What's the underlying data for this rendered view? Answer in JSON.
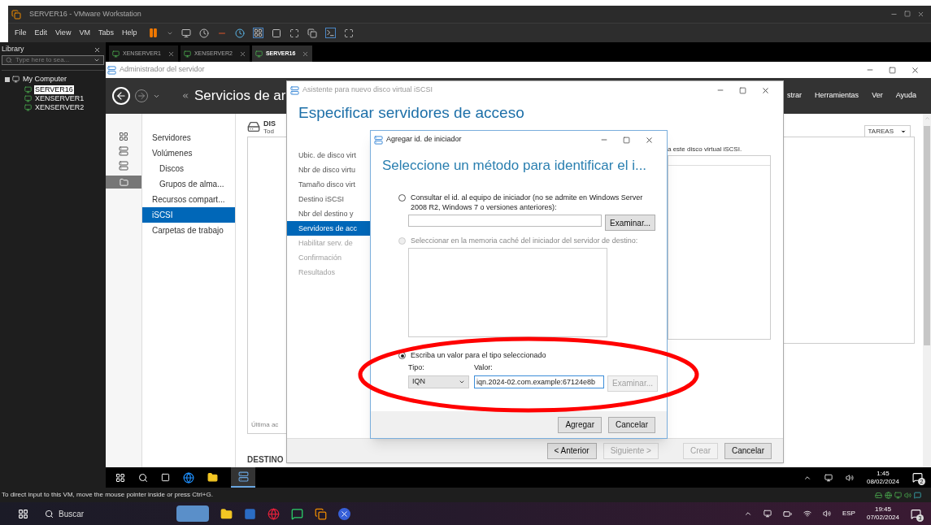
{
  "vmware": {
    "title": "SERVER16 - VMware Workstation",
    "menu": [
      "File",
      "Edit",
      "View",
      "VM",
      "Tabs",
      "Help"
    ]
  },
  "library": {
    "title": "Library",
    "search_placeholder": "Type here to sea...",
    "tree": [
      {
        "label": "My Computer",
        "expanded": true,
        "selected": false,
        "children": [
          {
            "label": "SERVER16",
            "selected": true
          },
          {
            "label": "XENSERVER1",
            "selected": false
          },
          {
            "label": "XENSERVER2",
            "selected": false
          }
        ]
      }
    ]
  },
  "vm_tabs": [
    {
      "label": "XENSERVER1",
      "selected": false
    },
    {
      "label": "XENSERVER2",
      "selected": false
    },
    {
      "label": "SERVER16",
      "selected": true
    }
  ],
  "server_manager": {
    "title": "Administrador del servidor",
    "breadcrumb": "Servicios de ar",
    "menu": [
      "strar",
      "Herramientas",
      "Ver",
      "Ayuda"
    ],
    "nav": [
      {
        "label": "Servidores",
        "selected": false
      },
      {
        "label": "Volúmenes",
        "selected": false,
        "children": [
          {
            "label": "Discos",
            "selected": false
          },
          {
            "label": "Grupos de alma...",
            "selected": false
          }
        ]
      },
      {
        "label": "Recursos compart...",
        "selected": false
      },
      {
        "label": "iSCSI",
        "selected": true
      },
      {
        "label": "Carpetas de trabajo",
        "selected": false
      }
    ],
    "content": {
      "heading": "DIS",
      "subheading": "Tod",
      "last_updated": "Última ac",
      "section": "DESTINO",
      "tasks_button": "TAREAS"
    }
  },
  "wizard": {
    "title": "Asistente para nuevo disco virtual iSCSI",
    "heading": "Especificar servidores de acceso",
    "steps": [
      {
        "label": "Ubic. de disco virt",
        "selected": false,
        "disabled": false
      },
      {
        "label": "Nbr de disco virtu",
        "selected": false,
        "disabled": false
      },
      {
        "label": "Tamaño disco virt",
        "selected": false,
        "disabled": false
      },
      {
        "label": "Destino iSCSI",
        "selected": false,
        "disabled": false
      },
      {
        "label": "Nbr del destino y",
        "selected": false,
        "disabled": false
      },
      {
        "label": "Servidores de acc",
        "selected": true,
        "disabled": false
      },
      {
        "label": "Habilitar serv. de",
        "selected": false,
        "disabled": true
      },
      {
        "label": "Confirmación",
        "selected": false,
        "disabled": true
      },
      {
        "label": "Resultados",
        "selected": false,
        "disabled": true
      }
    ],
    "note": "a este disco virtual iSCSI.",
    "buttons": [
      {
        "label": "< Anterior",
        "disabled": false
      },
      {
        "label": "Siguiente >",
        "disabled": true
      },
      {
        "label": "Crear",
        "disabled": true
      },
      {
        "label": "Cancelar",
        "disabled": false
      }
    ]
  },
  "dialog": {
    "title": "Agregar id. de iniciador",
    "heading": "Seleccione un método para identificar el i...",
    "options": [
      {
        "kind": "query",
        "label": "Consultar el id. al equipo de iniciador (no se admite en Windows Server 2008 R2, Windows 7 o versiones anteriores):",
        "selected": false,
        "disabled": false,
        "browse": {
          "label": "Examinar...",
          "disabled": false
        }
      },
      {
        "kind": "cache",
        "label": "Seleccionar en la memoria caché del iniciador del servidor de destino:",
        "selected": false,
        "disabled": true
      },
      {
        "kind": "typed",
        "label": "Escriba un valor para el tipo seleccionado",
        "selected": true,
        "disabled": false,
        "type_label": "Tipo:",
        "type_value": "IQN",
        "value_label": "Valor:",
        "value": "iqn.2024-02.com.example:67124e8b",
        "browse": {
          "label": "Examinar...",
          "disabled": true
        }
      }
    ],
    "buttons": [
      "Agregar",
      "Cancelar"
    ]
  },
  "guest_taskbar": {
    "time": "1:45",
    "date": "08/02/2024",
    "notifications": "2"
  },
  "status_bar": "To direct input to this VM, move the mouse pointer inside or press Ctrl+G.",
  "host_taskbar": {
    "search_placeholder": "Buscar",
    "language": "ESP",
    "time": "19:45",
    "date": "07/02/2024",
    "notifications": "3"
  }
}
